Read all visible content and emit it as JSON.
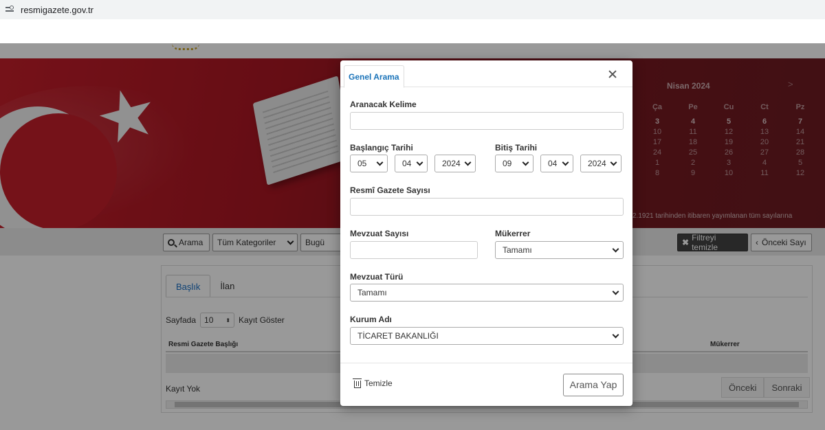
{
  "browser": {
    "url": "resmigazete.gov.tr"
  },
  "calendar": {
    "month_label": "Nisan 2024",
    "next_label": ">",
    "weekdays": [
      "Ça",
      "Pe",
      "Cu",
      "Ct",
      "Pz"
    ],
    "rows": [
      [
        "3",
        "4",
        "5",
        "6",
        "7"
      ],
      [
        "10",
        "11",
        "12",
        "13",
        "14"
      ],
      [
        "17",
        "18",
        "19",
        "20",
        "21"
      ],
      [
        "24",
        "25",
        "26",
        "27",
        "28"
      ],
      [
        "1",
        "2",
        "3",
        "4",
        "5"
      ],
      [
        "8",
        "9",
        "10",
        "11",
        "12"
      ]
    ],
    "note": "2.1921 tarihinden itibaren yayımlanan tüm sayılarına"
  },
  "toolbar": {
    "search_label": "Arama",
    "category_label": "Tüm Kategoriler",
    "date_partial": "Bugü",
    "clear_filter_label": "Filtreyi temizle",
    "prev_issue_label": "Önceki Sayı"
  },
  "content": {
    "tabs": [
      "Başlık",
      "İlan"
    ],
    "sayfada_label": "Sayfada",
    "page_size": "10",
    "kayit_goster": "Kayıt Göster",
    "col_title": "Resmi Gazete Başlığı",
    "col_mukerrer": "Mükerrer",
    "no_records": "Kayıt Yok",
    "prev_btn": "Önceki",
    "next_btn": "Sonraki"
  },
  "modal": {
    "tab_label": "Genel Arama",
    "keyword": {
      "label": "Aranacak Kelime",
      "value": ""
    },
    "start_date": {
      "label": "Başlangıç Tarihi",
      "day": "05",
      "month": "04",
      "year": "2024"
    },
    "end_date": {
      "label": "Bitiş Tarihi",
      "day": "09",
      "month": "04",
      "year": "2024"
    },
    "gazette_number": {
      "label": "Resmî Gazete Sayısı",
      "value": ""
    },
    "legislation_number": {
      "label": "Mevzuat Sayısı",
      "value": ""
    },
    "mukerrer": {
      "label": "Mükerrer",
      "value": "Tamamı"
    },
    "legislation_type": {
      "label": "Mevzuat Türü",
      "value": "Tamamı"
    },
    "institution": {
      "label": "Kurum Adı",
      "value": "TİCARET BAKANLIĞI"
    },
    "clear_label": "Temizle",
    "search_button": "Arama Yap"
  },
  "colors": {
    "accent": "#1a73b9",
    "banner_red": "#c41e2a"
  }
}
